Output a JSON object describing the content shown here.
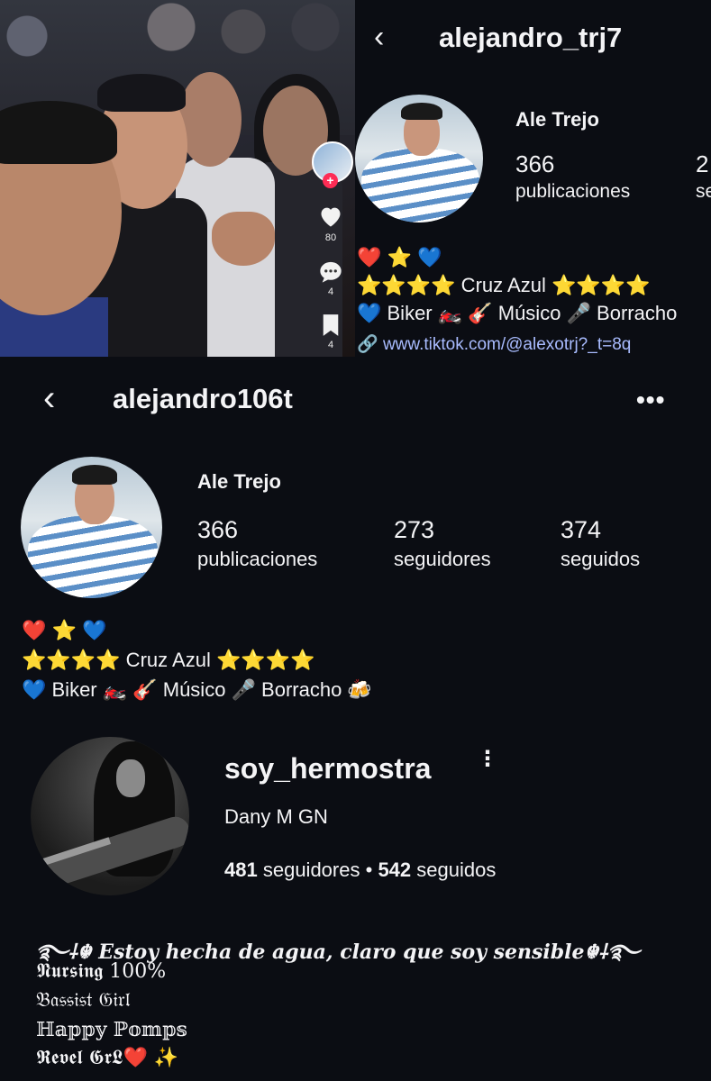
{
  "tiktok_overlay": {
    "like_count": "80",
    "comment_count": "4",
    "save_count": "4",
    "plus_icon": "+"
  },
  "top_profile": {
    "back_icon": "‹",
    "username": "alejandro_trj7",
    "display_name": "Ale Trejo",
    "posts_count": "366",
    "posts_label": "publicaciones",
    "second_count_partial": "2",
    "second_label_partial": "se",
    "bio_lines": [
      "❤️ ⭐ 💙",
      "⭐⭐⭐⭐ Cruz Azul ⭐⭐⭐⭐",
      "💙 Biker 🏍️ 🎸 Músico 🎤 Borracho"
    ],
    "link": "www.tiktok.com/@alexotrj?_t=8q"
  },
  "main_profile": {
    "back_icon": "‹",
    "username": "alejandro106t",
    "more_icon": "•••",
    "display_name": "Ale Trejo",
    "stats": [
      {
        "count": "366",
        "label": "publicaciones"
      },
      {
        "count": "273",
        "label": "seguidores"
      },
      {
        "count": "374",
        "label": "seguidos"
      }
    ],
    "bio_lines": [
      "❤️ ⭐ 💙",
      "⭐⭐⭐⭐ Cruz Azul ⭐⭐⭐⭐",
      "💙 Biker 🏍️ 🎸 Músico 🎤 Borracho 🍻"
    ]
  },
  "second_account": {
    "username": "soy_hermostra",
    "menu_icon": "⋮",
    "display_name": "Dany M GN",
    "followers_count": "481",
    "followers_label": "seguidores",
    "separator": "•",
    "following_count": "542",
    "following_label": "seguidos",
    "bio_lines": [
      "࿐⸸☬ Estoy hecha de agua, claro que soy sensible☬⸸࿐",
      "𝕹𝖚𝖗𝖘𝖎𝖓𝖌 100%",
      "𝔅𝔞𝔰𝔰𝔦𝔰𝔱 𝔊𝔦𝔯𝔩",
      "ℍ𝕒𝕡𝕡𝕪 ℙ𝕠𝕞𝕡𝕤",
      "𝕽𝖊𝖛𝖊𝖑 𝕲𝖗𝕷❤️ ✨"
    ]
  }
}
